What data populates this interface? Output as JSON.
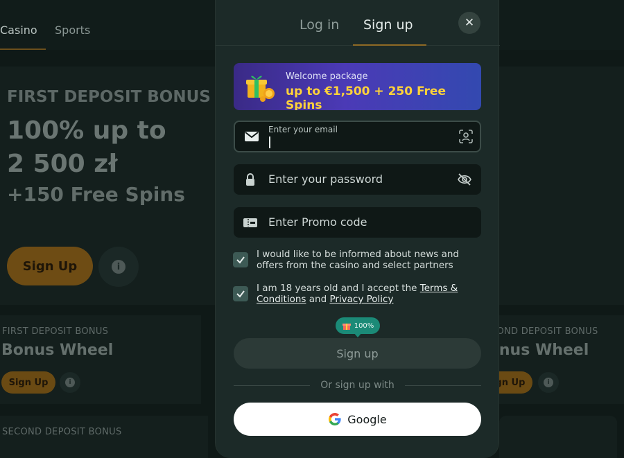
{
  "background": {
    "nav_tabs": [
      "Casino",
      "Sports"
    ],
    "hero": {
      "caption": "FIRST DEPOSIT BONUS",
      "line1": "100% up to",
      "line2": "2 500 zł",
      "line3": "+150 Free Spins",
      "button": "Sign Up",
      "info": "i"
    },
    "cards": [
      {
        "caption": "FIRST DEPOSIT BONUS",
        "title": "Bonus Wheel",
        "button": "Sign Up"
      },
      {
        "caption": "SECOND DEPOSIT BONUS",
        "title": "Bonus Wheel",
        "button": "Sign Up"
      }
    ],
    "bottom_caption": "SECOND DEPOSIT BONUS"
  },
  "modal": {
    "tabs": {
      "login": "Log in",
      "signup": "Sign up"
    },
    "close_icon": "close-icon",
    "promo": {
      "line1": "Welcome package",
      "line2": "up to €1,500 + 250 Free Spins",
      "icon": "gift-icon"
    },
    "email": {
      "label": "Enter your email",
      "value": ""
    },
    "password": {
      "placeholder": "Enter your password"
    },
    "promo_code": {
      "placeholder": "Enter Promo code"
    },
    "consent_news": "I would like to be informed about news and offers from the casino and select partners",
    "consent_terms": {
      "prefix": "I am 18 years old and I accept the ",
      "terms_link": "Terms & Conditions",
      "and": " and ",
      "privacy_link": "Privacy Policy"
    },
    "badge_percent": "100%",
    "signup_button": "Sign up",
    "or_text": "Or sign up with",
    "google_button": "Google"
  },
  "colors": {
    "accent_gold": "#8f6a25",
    "checkbox_bg": "#3d5a55",
    "badge_green": "#1b8a77",
    "promo_yellow": "#ffd23a"
  }
}
